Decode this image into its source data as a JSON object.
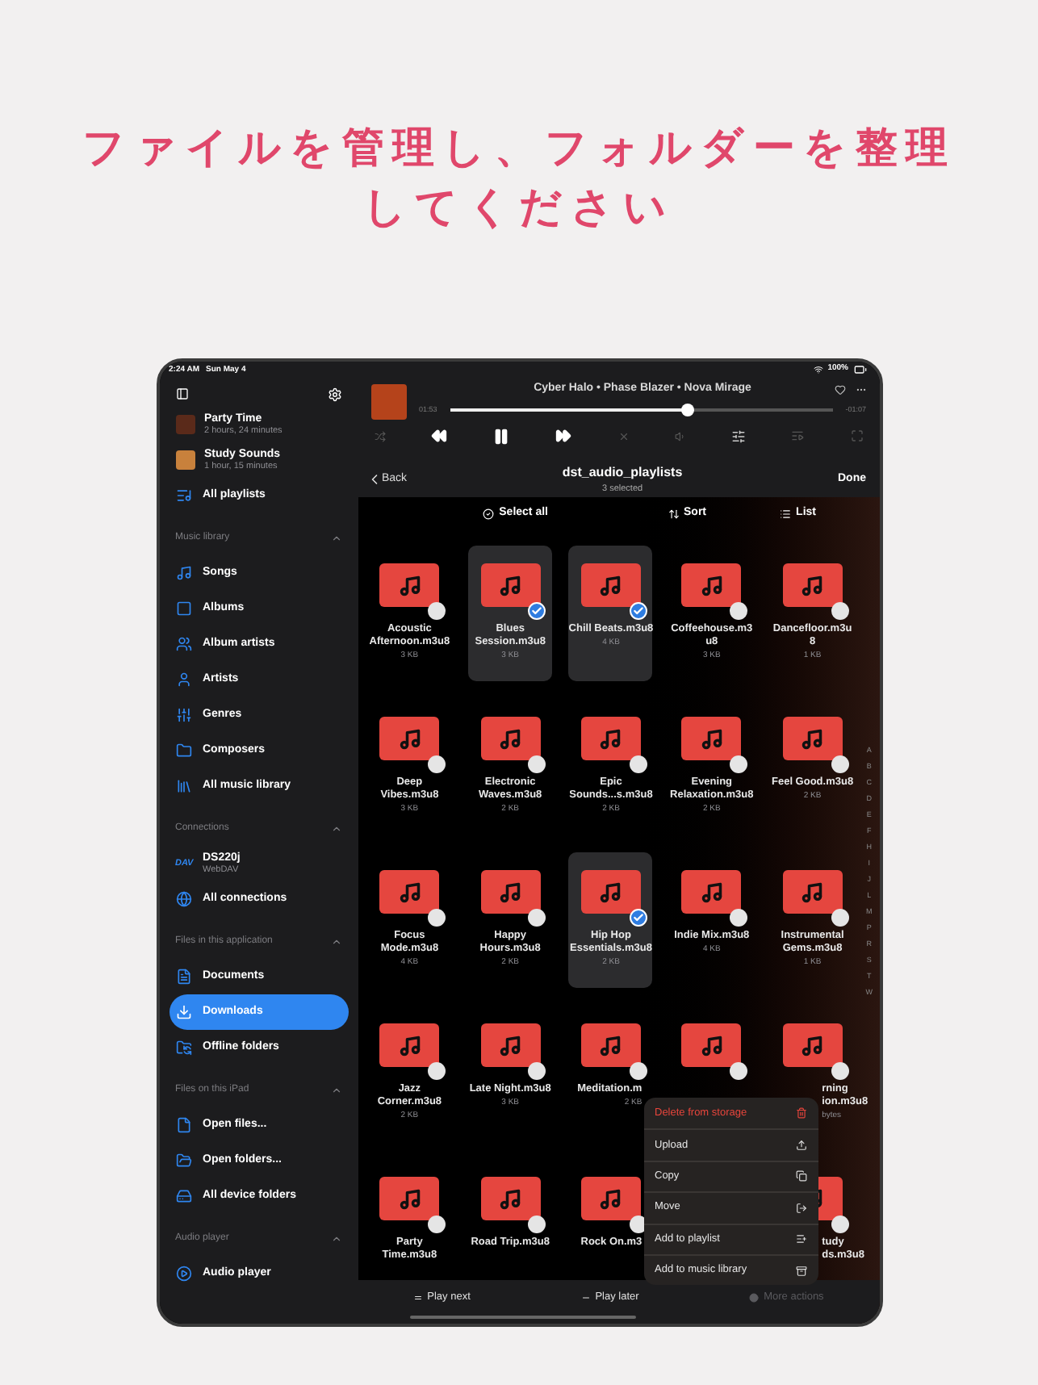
{
  "headline_lines": [
    "ファイルを管理し、フォルダーを整理",
    "してください"
  ],
  "status_bar": {
    "time": "2:24 AM",
    "date": "Sun May 4",
    "battery": "100%"
  },
  "sidebar": {
    "playlists": [
      {
        "title": "Party Time",
        "subtitle": "2 hours, 24 minutes"
      },
      {
        "title": "Study Sounds",
        "subtitle": "1 hour, 15 minutes"
      }
    ],
    "all_playlists": "All playlists",
    "sections": [
      {
        "title": "Music library",
        "expanded": true,
        "items": [
          {
            "label": "Songs",
            "selected": false
          },
          {
            "label": "Albums",
            "selected": false
          },
          {
            "label": "Album artists",
            "selected": false
          },
          {
            "label": "Artists",
            "selected": false
          },
          {
            "label": "Genres",
            "selected": false
          },
          {
            "label": "Composers",
            "selected": false
          },
          {
            "label": "All music library",
            "selected": false
          }
        ]
      },
      {
        "title": "Connections",
        "expanded": true,
        "items": [
          {
            "label": "DS220j",
            "subtitle": "WebDAV",
            "badge": "DAV",
            "selected": false
          },
          {
            "label": "All connections",
            "selected": false
          }
        ]
      },
      {
        "title": "Files in this application",
        "expanded": true,
        "items": [
          {
            "label": "Documents",
            "selected": false
          },
          {
            "label": "Downloads",
            "selected": true
          },
          {
            "label": "Offline folders",
            "selected": false
          }
        ]
      },
      {
        "title": "Files on this iPad",
        "expanded": true,
        "items": [
          {
            "label": "Open files...",
            "selected": false
          },
          {
            "label": "Open folders...",
            "selected": false
          },
          {
            "label": "All device folders",
            "selected": false
          }
        ]
      },
      {
        "title": "Audio player",
        "expanded": true,
        "items": [
          {
            "label": "Audio player",
            "selected": false
          }
        ]
      }
    ]
  },
  "player": {
    "title": "Cyber Halo • Phase Blazer • Nova Mirage",
    "elapsed": "01:53",
    "remaining": "-01:07",
    "level": 0.62,
    "playing": true
  },
  "nav": {
    "back": "Back",
    "title": "dst_audio_playlists",
    "subtitle": "3 selected",
    "done": "Done"
  },
  "actions": {
    "select_all": "Select all",
    "sort": "Sort",
    "list": "List"
  },
  "tiles": [
    {
      "name_lines": [
        "Acoustic",
        "Afternoon.m3u8"
      ],
      "size": "3 KB",
      "selected": false
    },
    {
      "name_lines": [
        "Blues",
        "Session.m3u8"
      ],
      "size": "3 KB",
      "selected": true
    },
    {
      "name_lines": [
        "Chill Beats.m3u8"
      ],
      "size": "4 KB",
      "selected": true
    },
    {
      "name_lines": [
        "Coffeehouse.m3",
        "u8"
      ],
      "size": "3 KB",
      "selected": false
    },
    {
      "name_lines": [
        "Dancefloor.m3u",
        "8"
      ],
      "size": "1 KB",
      "selected": false
    },
    {
      "name_lines": [
        "Deep",
        "Vibes.m3u8"
      ],
      "size": "3 KB",
      "selected": false
    },
    {
      "name_lines": [
        "Electronic",
        "Waves.m3u8"
      ],
      "size": "2 KB",
      "selected": false
    },
    {
      "name_lines": [
        "Epic",
        "Sounds...s.m3u8"
      ],
      "size": "2 KB",
      "selected": false
    },
    {
      "name_lines": [
        "Evening",
        "Relaxation.m3u8"
      ],
      "size": "2 KB",
      "selected": false
    },
    {
      "name_lines": [
        "Feel Good.m3u8"
      ],
      "size": "2 KB",
      "selected": false
    },
    {
      "name_lines": [
        "Focus",
        "Mode.m3u8"
      ],
      "size": "4 KB",
      "selected": false
    },
    {
      "name_lines": [
        "Happy",
        "Hours.m3u8"
      ],
      "size": "2 KB",
      "selected": false
    },
    {
      "name_lines": [
        "Hip Hop",
        "Essentials.m3u8"
      ],
      "size": "2 KB",
      "selected": true
    },
    {
      "name_lines": [
        "Indie Mix.m3u8"
      ],
      "size": "4 KB",
      "selected": false
    },
    {
      "name_lines": [
        "Instrumental",
        "Gems.m3u8"
      ],
      "size": "1 KB",
      "selected": false
    },
    {
      "name_lines": [
        "Jazz",
        "Corner.m3u8"
      ],
      "size": "2 KB",
      "selected": false
    },
    {
      "name_lines": [
        "Late Night.m3u8"
      ],
      "size": "3 KB",
      "selected": false
    },
    {
      "name_lines": [
        "Meditation.m"
      ],
      "size": "2 KB",
      "selected": false
    },
    {
      "selected": false
    },
    {
      "name_lines": [
        "rning",
        "ion.m3u8"
      ],
      "size": "bytes",
      "selected": false
    },
    {
      "name_lines": [
        "Party",
        "Time.m3u8"
      ],
      "selected": false
    },
    {
      "name_lines": [
        "Road Trip.m3u8"
      ],
      "selected": false
    },
    {
      "name_lines": [
        "Rock On.m3"
      ],
      "selected": false
    },
    {
      "name_lines": [
        "tudy",
        "ds.m3u8"
      ],
      "selected": false
    }
  ],
  "index_letters": [
    "A",
    "B",
    "C",
    "D",
    "E",
    "F",
    "H",
    "I",
    "J",
    "L",
    "M",
    "P",
    "R",
    "S",
    "T",
    "W"
  ],
  "context_menu": [
    {
      "label": "Delete from storage",
      "kind": "destructive"
    },
    {
      "label": "Upload",
      "kind": "normal"
    },
    {
      "label": "Copy",
      "kind": "normal"
    },
    {
      "label": "Move",
      "kind": "normal"
    },
    {
      "label": "Add to playlist",
      "kind": "normal"
    },
    {
      "label": "Add to music library",
      "kind": "normal"
    }
  ],
  "toolbar": [
    {
      "label": "Play next",
      "disabled": false
    },
    {
      "label": "Play later",
      "disabled": false
    },
    {
      "label": "More actions",
      "disabled": true
    }
  ]
}
